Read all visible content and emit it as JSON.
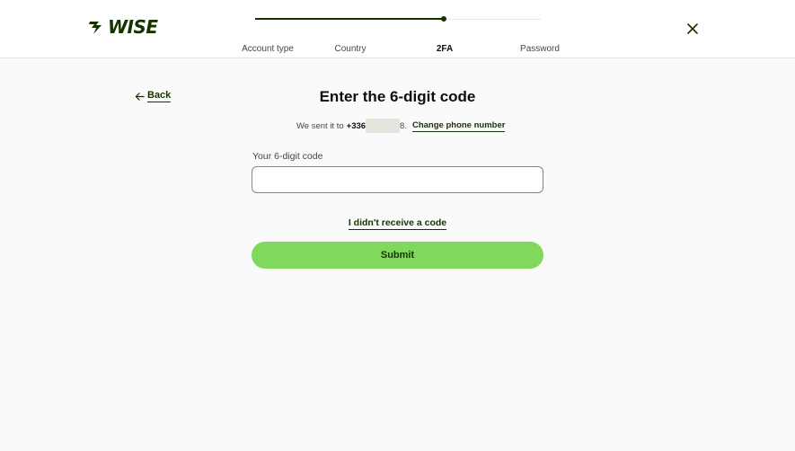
{
  "brand": {
    "logo_text": "WISE",
    "color": "#163300"
  },
  "stepper": {
    "steps": [
      {
        "label": "Account type",
        "state": "done"
      },
      {
        "label": "Country",
        "state": "done"
      },
      {
        "label": "2FA",
        "state": "current"
      },
      {
        "label": "Password",
        "state": "upcoming"
      }
    ],
    "progress": 0.66
  },
  "nav": {
    "back_label": "Back",
    "close_icon": "close-icon",
    "back_icon": "arrow-left-icon"
  },
  "main": {
    "title": "Enter the 6-digit code",
    "sent_prefix": "We sent it to",
    "sent_number": "+336",
    "sent_suffix": "8.",
    "change_link": "Change phone number",
    "field_label": "Your 6-digit code",
    "field_value": "",
    "no_code_link": "I didn't receive a code",
    "submit_label": "Submit"
  },
  "colors": {
    "accent": "#80d95d",
    "forest": "#163300",
    "background": "#fafafb"
  }
}
